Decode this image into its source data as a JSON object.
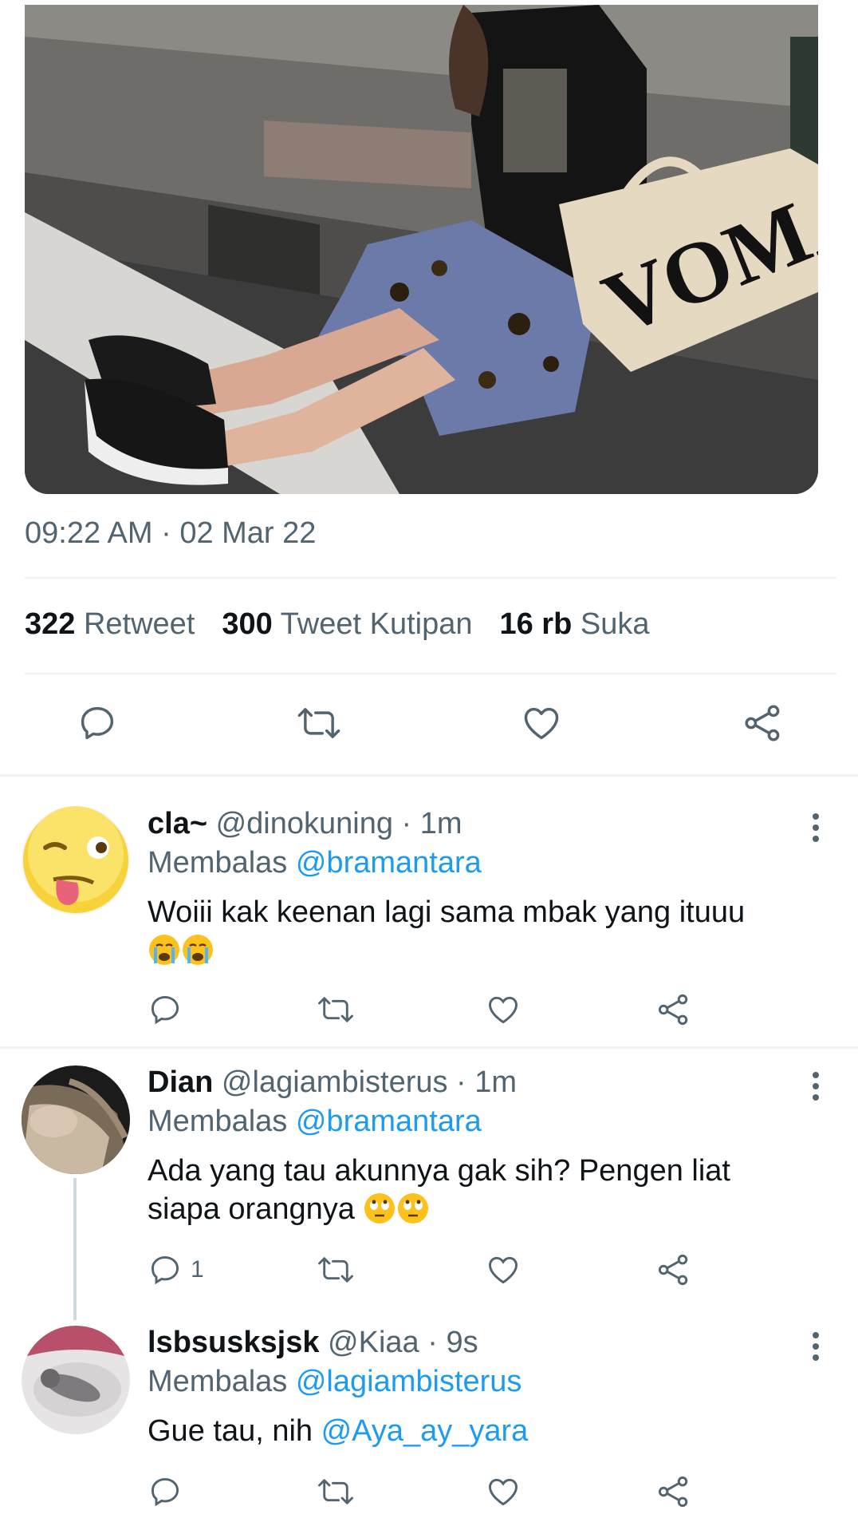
{
  "tweet": {
    "timestamp": "09:22 AM · 02 Mar 22",
    "stats": [
      {
        "count": "322",
        "label": "Retweet"
      },
      {
        "count": "300",
        "label": "Tweet Kutipan"
      },
      {
        "count": "16 rb",
        "label": "Suka"
      }
    ],
    "media": {
      "bag_text": "VOMAN"
    }
  },
  "icons": {
    "reply": "reply-icon",
    "retweet": "retweet-icon",
    "like": "heart-icon",
    "share": "share-icon",
    "more": "more-vertical-icon"
  },
  "replies": [
    {
      "name": "cla~",
      "handle": "@dinokuning",
      "time": "1m",
      "replying_label": "Membalas",
      "replying_to": "@bramantara",
      "text": "Woiii kak keenan lagi sama mbak yang ituuu",
      "emoji": [
        "crying-face",
        "crying-face"
      ],
      "reply_count": ""
    },
    {
      "name": "Dian",
      "handle": "@lagiambisterus",
      "time": "1m",
      "replying_label": "Membalas",
      "replying_to": "@bramantara",
      "text": "Ada yang tau akunnya gak sih? Pengen liat siapa orangnya",
      "emoji": [
        "eye-roll-face",
        "eye-roll-face"
      ],
      "reply_count": "1"
    },
    {
      "name": "lsbsusksjsk",
      "handle": "@Kiaa",
      "time": "9s",
      "replying_label": "Membalas",
      "replying_to": "@lagiambisterus",
      "text": "Gue tau, nih ",
      "text_mention": "@Aya_ay_yara",
      "reply_count": ""
    }
  ],
  "colors": {
    "accent": "#1d9bf0",
    "secondary": "#536471",
    "primary": "#0f1419",
    "divider": "#eff3f4"
  }
}
